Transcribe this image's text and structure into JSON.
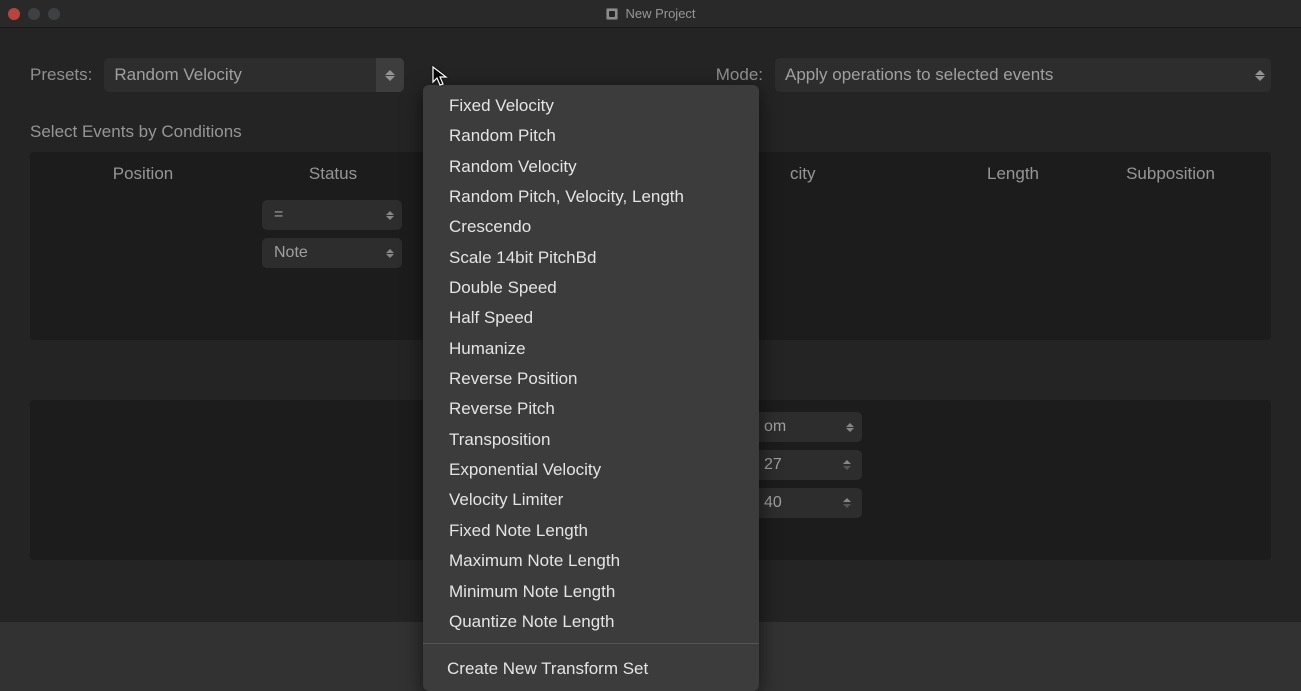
{
  "window": {
    "title": "New Project"
  },
  "toolbar": {
    "presets_label": "Presets:",
    "presets_value": "Random Velocity",
    "mode_label": "Mode:",
    "mode_value": "Apply operations to selected events"
  },
  "section1": {
    "title": "Select Events by Conditions",
    "columns": {
      "position": "Position",
      "status": "Status",
      "velocity": "city",
      "length": "Length",
      "subposition": "Subposition"
    },
    "status_op": "=",
    "status_value": "Note"
  },
  "section2": {
    "right_sel": "om",
    "value1": "27",
    "value2": "40"
  },
  "menu": {
    "items": [
      "Fixed Velocity",
      "Random Pitch",
      "Random Velocity",
      "Random Pitch, Velocity, Length",
      "Crescendo",
      "Scale 14bit PitchBd",
      "Double Speed",
      "Half Speed",
      "Humanize",
      "Reverse Position",
      "Reverse Pitch",
      "Transposition",
      "Exponential Velocity",
      "Velocity Limiter",
      "Fixed Note Length",
      "Maximum Note Length",
      "Minimum Note Length",
      "Quantize Note Length"
    ],
    "footer": "Create New Transform Set"
  }
}
